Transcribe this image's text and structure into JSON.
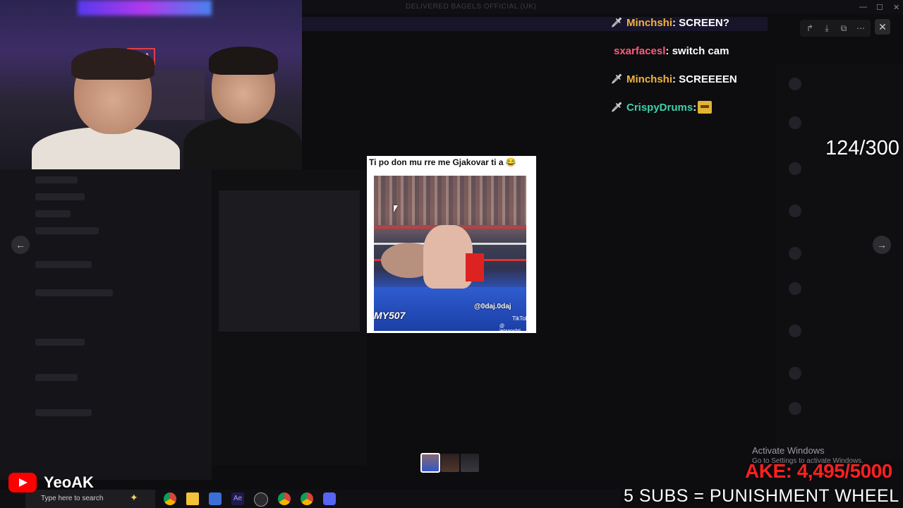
{
  "background": {
    "window_title": "DELIVERED BAGELS OFFICIAL (UK)"
  },
  "chat": [
    {
      "icon": "sword-icon",
      "name": "Minchshi",
      "name_color": "#f2b33d",
      "message": ": SCREEN?"
    },
    {
      "icon": "",
      "name": "sxarfacesl",
      "name_color": "#ff5a7a",
      "message": ": switch cam"
    },
    {
      "icon": "sword-icon",
      "name": "Minchshi",
      "name_color": "#f2b33d",
      "message": ": SCREEEEN"
    },
    {
      "icon": "sword-icon",
      "name": "CrispyDrums",
      "name_color": "#3ed1a8",
      "message": ":",
      "emote": "emote-icon"
    }
  ],
  "counter": "124/300",
  "viewer": {
    "caption": "Ti po don mu rre me Gjakovar ti a",
    "caption_emoji": "😂",
    "video_handle": "@0daj.0daj",
    "video_logo": "MY507",
    "video_tiktok": "TikTok",
    "video_credit": "@ jetaaoshti"
  },
  "windows_watermark": {
    "title": "Activate Windows",
    "subtitle": "Go to Settings to activate Windows."
  },
  "overlay": {
    "goal_text": "AKE: 4,495/5000",
    "punish_text": "5 SUBS = PUNISHMENT WHEEL"
  },
  "youtube": {
    "name": "YeoAK"
  },
  "taskbar": {
    "search_placeholder": "Type here to search"
  },
  "colors": {
    "goal": "#ff2020",
    "accent_discord": "#5865f2"
  }
}
